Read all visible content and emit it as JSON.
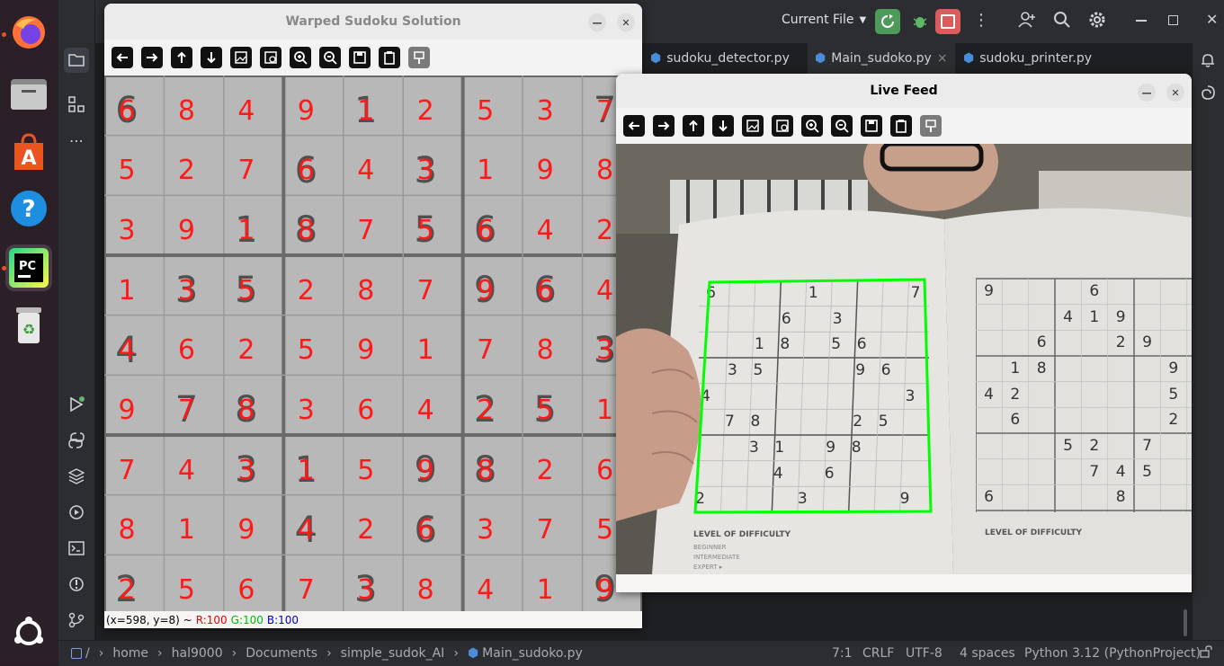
{
  "dock": {
    "items": [
      "firefox-icon",
      "files-icon",
      "app-center-icon",
      "help-icon",
      "pycharm-icon",
      "trash-icon"
    ]
  },
  "ide": {
    "logo": "PC",
    "run_config": "Current File",
    "tabs": [
      {
        "label": "sudoku_detector.py"
      },
      {
        "label": "Main_sudoko.py",
        "close": "×"
      },
      {
        "label": "sudoku_printer.py"
      }
    ],
    "status": {
      "breadcrumb": [
        "/",
        "home",
        "hal9000",
        "Documents",
        "simple_sudok_AI",
        "Main_sudoko.py"
      ],
      "position": "7:1",
      "line_ending": "CRLF",
      "encoding": "UTF-8",
      "indent": "4 spaces",
      "interpreter": "Python 3.12 (PythonProject)"
    }
  },
  "warped": {
    "title": "Warped Sudoku Solution",
    "status": {
      "coords": "(x=598, y=8) ~",
      "r": "R:100",
      "g": "G:100",
      "b": "B:100"
    },
    "solution": [
      [
        6,
        8,
        4,
        9,
        1,
        2,
        5,
        3,
        7
      ],
      [
        5,
        2,
        7,
        6,
        4,
        3,
        1,
        9,
        8
      ],
      [
        3,
        9,
        1,
        8,
        7,
        5,
        6,
        4,
        2
      ],
      [
        1,
        3,
        5,
        2,
        8,
        7,
        9,
        6,
        4
      ],
      [
        4,
        6,
        2,
        5,
        9,
        1,
        7,
        8,
        3
      ],
      [
        9,
        7,
        8,
        3,
        6,
        4,
        2,
        5,
        1
      ],
      [
        7,
        4,
        3,
        1,
        5,
        9,
        8,
        2,
        6
      ],
      [
        8,
        1,
        9,
        4,
        2,
        6,
        3,
        7,
        5
      ],
      [
        2,
        5,
        6,
        7,
        3,
        8,
        4,
        1,
        9
      ]
    ],
    "givens": [
      [
        6,
        0,
        0,
        0,
        1,
        0,
        0,
        0,
        7
      ],
      [
        0,
        0,
        0,
        6,
        0,
        3,
        0,
        0,
        0
      ],
      [
        0,
        0,
        1,
        8,
        0,
        5,
        6,
        0,
        0
      ],
      [
        0,
        3,
        5,
        0,
        0,
        0,
        9,
        6,
        0
      ],
      [
        4,
        0,
        0,
        0,
        0,
        0,
        0,
        0,
        3
      ],
      [
        0,
        7,
        8,
        0,
        0,
        0,
        2,
        5,
        0
      ],
      [
        0,
        0,
        3,
        1,
        0,
        9,
        8,
        0,
        0
      ],
      [
        0,
        0,
        0,
        4,
        0,
        6,
        0,
        0,
        0
      ],
      [
        2,
        0,
        0,
        0,
        3,
        0,
        0,
        0,
        9
      ]
    ]
  },
  "live": {
    "title": "Live Feed",
    "puzzle_left": [
      [
        6,
        0,
        0,
        0,
        1,
        0,
        0,
        0,
        7
      ],
      [
        0,
        0,
        0,
        6,
        0,
        3,
        0,
        0,
        0
      ],
      [
        0,
        0,
        1,
        8,
        0,
        5,
        6,
        0,
        0
      ],
      [
        0,
        3,
        5,
        0,
        0,
        0,
        9,
        6,
        0
      ],
      [
        4,
        0,
        0,
        0,
        0,
        0,
        0,
        0,
        3
      ],
      [
        0,
        7,
        8,
        0,
        0,
        0,
        2,
        5,
        0
      ],
      [
        0,
        0,
        3,
        1,
        0,
        9,
        8,
        0,
        0
      ],
      [
        0,
        0,
        0,
        4,
        0,
        6,
        0,
        0,
        0
      ],
      [
        2,
        0,
        0,
        0,
        3,
        0,
        0,
        0,
        9
      ]
    ],
    "right_page_digits": [
      "9",
      "6",
      "4",
      "1",
      "9",
      "6",
      "2",
      "9",
      "1",
      "8",
      "9",
      "4",
      "2",
      "5",
      "6",
      "2",
      "4",
      "5",
      "2",
      "7",
      "7",
      "4",
      "5",
      "6",
      "8"
    ],
    "caption": "LEVEL OF DIFFICULTY",
    "levels": [
      "BEGINNER",
      "INTERMEDIATE",
      "EXPERT ▸"
    ]
  },
  "colors": {
    "accent_green": "#00ff00",
    "solution_red": "#ff1a1a",
    "run_green": "#4e9a5a",
    "stop_red": "#db5c5c"
  }
}
